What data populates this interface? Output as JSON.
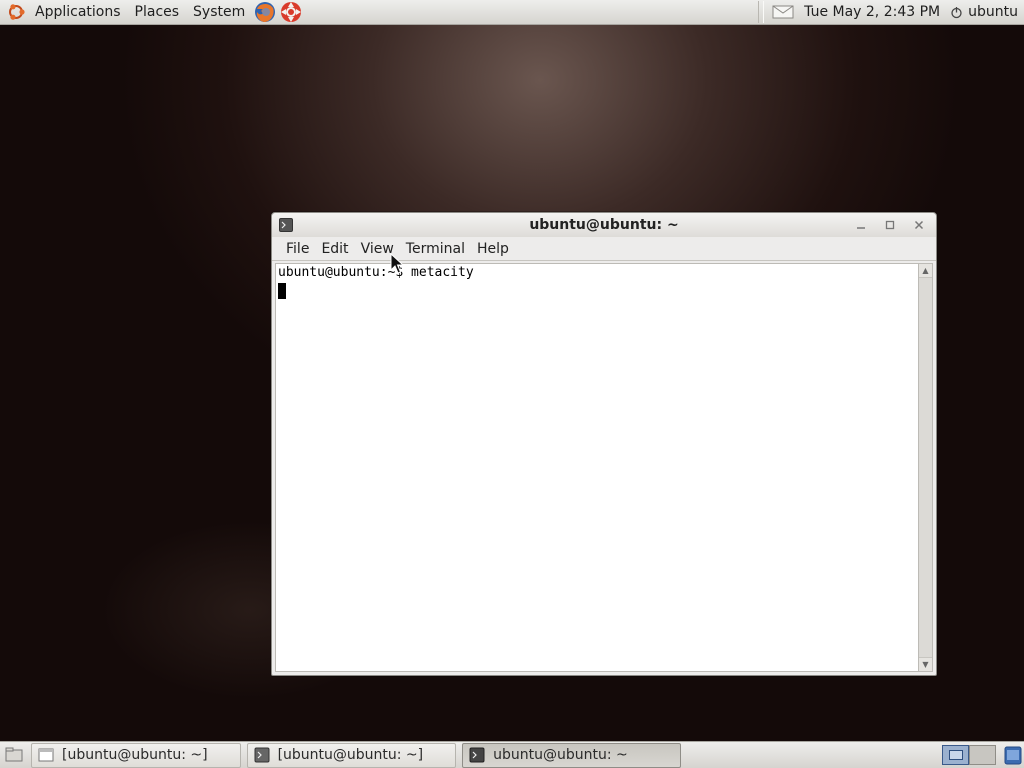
{
  "top_panel": {
    "menus": [
      "Applications",
      "Places",
      "System"
    ],
    "clock": "Tue May  2,  2:43 PM",
    "user": "ubuntu"
  },
  "window": {
    "title": "ubuntu@ubuntu: ~",
    "menu": [
      "File",
      "Edit",
      "View",
      "Terminal",
      "Help"
    ],
    "terminal": {
      "lines": [
        "ubuntu@ubuntu:~$ metacity"
      ]
    }
  },
  "taskbar": {
    "tasks": [
      {
        "label": "[ubuntu@ubuntu: ~]",
        "active": false
      },
      {
        "label": "[ubuntu@ubuntu: ~]",
        "active": false
      },
      {
        "label": "ubuntu@ubuntu: ~",
        "active": true
      }
    ]
  },
  "colors": {
    "desktop": "#2b1a17",
    "panel": "#e2e0dc",
    "active_workspace": "#9bb1cf"
  }
}
